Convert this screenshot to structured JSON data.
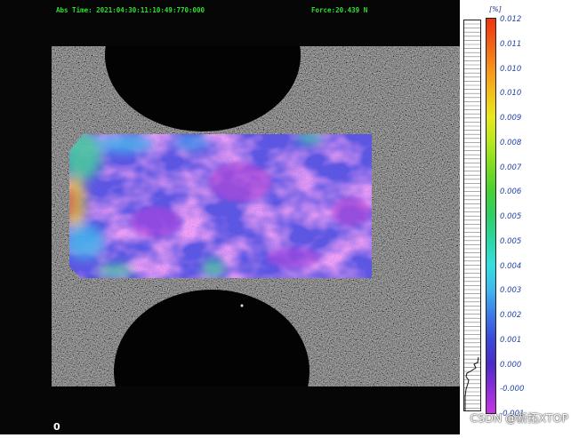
{
  "hud": {
    "abs_time": "Abs Time: 2021:04:30:11:10:49:770:000",
    "force": "Force:20.439 N"
  },
  "frame_index": "0",
  "scale": {
    "unit": "[%]",
    "labels": [
      "0.012",
      "0.011",
      "0.010",
      "0.010",
      "0.009",
      "0.008",
      "0.007",
      "0.006",
      "0.005",
      "0.005",
      "0.004",
      "0.003",
      "0.002",
      "0.001",
      "0.000",
      "-0.000",
      "-0.001"
    ],
    "colors": [
      "#ee3311",
      "#f05f14",
      "#f6911a",
      "#f4be1a",
      "#e8ea1c",
      "#b6e81e",
      "#7ddc22",
      "#46d133",
      "#2ecf69",
      "#2bd7a4",
      "#33dfe0",
      "#3fb6ee",
      "#3d7ae8",
      "#3a47d6",
      "#4a2cc6",
      "#8a2fd8",
      "#c437e2"
    ]
  },
  "watermark": "CSDN @新拓XTOP",
  "icons": {
    "histogram": "strain-histogram-icon"
  }
}
